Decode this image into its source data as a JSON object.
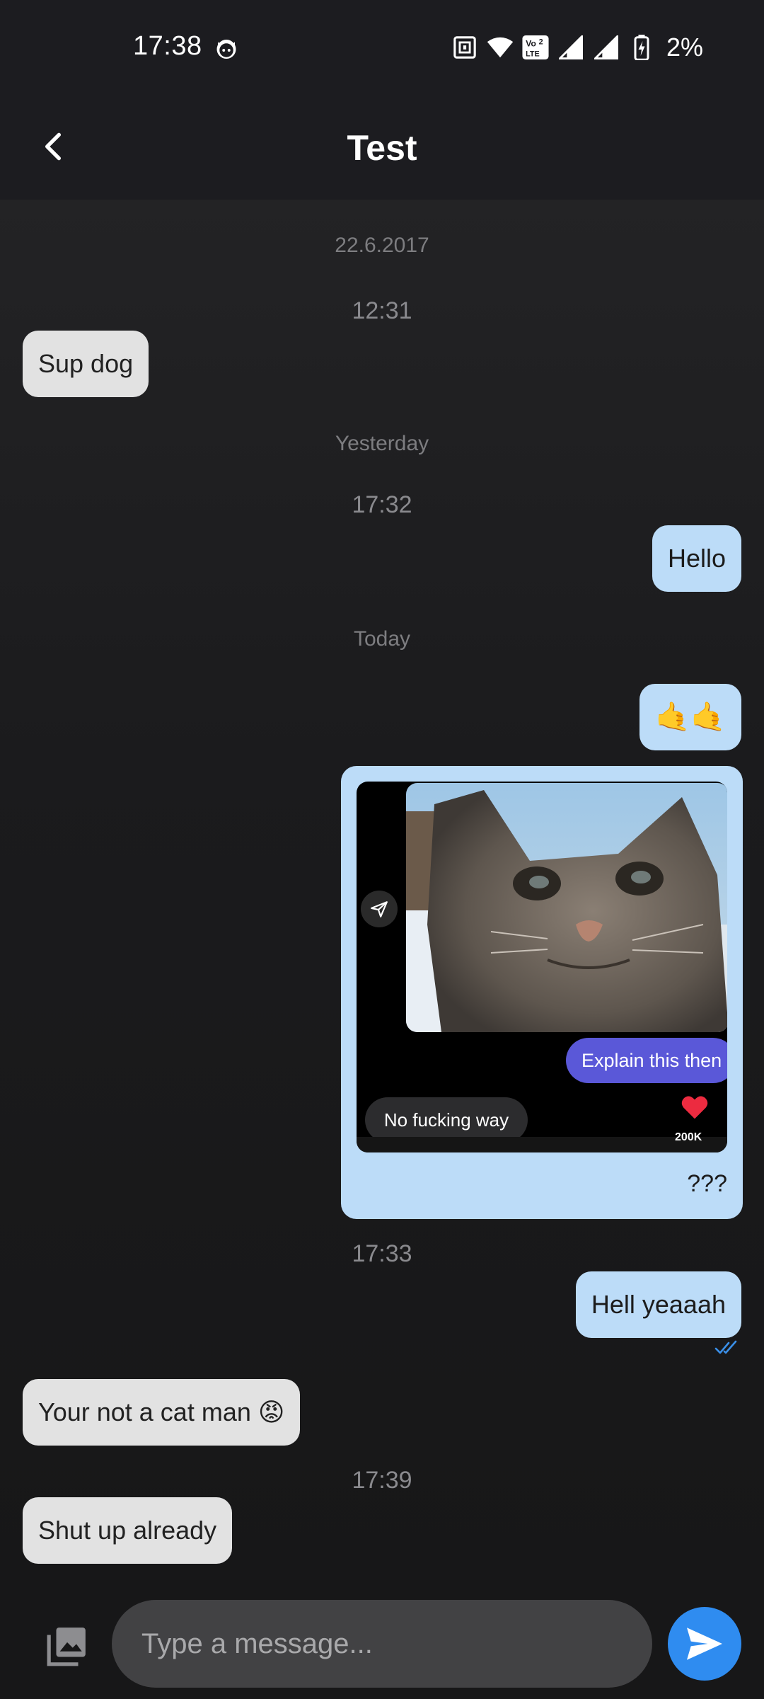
{
  "status_bar": {
    "time": "17:38",
    "battery": "2%",
    "icons": [
      "cat-face-icon",
      "nfc-icon",
      "wifi-icon",
      "volte-icon",
      "signal-icon",
      "signal-icon",
      "battery-charging-icon"
    ]
  },
  "app_bar": {
    "title": "Test",
    "back_icon": "chevron-left-icon"
  },
  "chat": {
    "date_1": "22.6.2017",
    "time_1": "12:31",
    "msg_sup": "Sup dog",
    "date_2": "Yesterday",
    "time_2": "17:32",
    "msg_hello": "Hello",
    "date_3": "Today",
    "msg_emoji": "🤙🤙",
    "media": {
      "overlay_purple": "Explain this then",
      "overlay_gray": "No fucking way",
      "likes": "200K",
      "caption": "???"
    },
    "time_3": "17:33",
    "msg_hell": "Hell yeaaah",
    "msg_cat": "Your not a cat man 😡",
    "time_4": "17:39",
    "msg_shut": "Shut up already"
  },
  "composer": {
    "placeholder": "Type a message...",
    "gallery_icon": "image-gallery-icon",
    "send_icon": "send-icon"
  },
  "colors": {
    "bubble_in": "#e2e2e2",
    "bubble_out": "#bcdcf8",
    "send_button": "#2f8cf0",
    "read_ticks": "#3a8fe8"
  }
}
